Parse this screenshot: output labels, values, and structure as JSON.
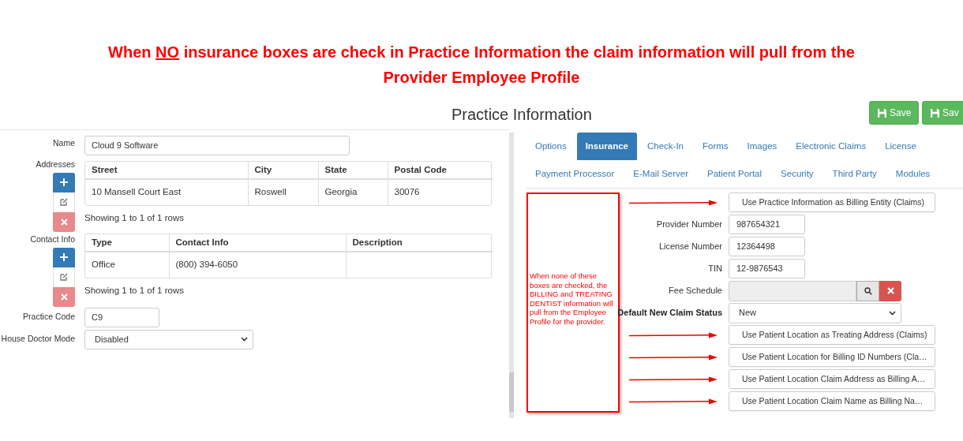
{
  "annotation": {
    "lead": "When ",
    "emphasis": "NO",
    "rest": " insurance boxes are check in Practice Information the claim information will pull from the Provider Employee Profile"
  },
  "page_title": "Practice Information",
  "save_buttons": [
    {
      "label": "Save"
    },
    {
      "label": "Sav"
    }
  ],
  "general": {
    "name": {
      "label": "Name",
      "value": "Cloud 9 Software"
    },
    "addresses": {
      "label": "Addresses",
      "columns": [
        "Street",
        "City",
        "State",
        "Postal Code"
      ],
      "rows": [
        [
          "10 Mansell Court East",
          "Roswell",
          "Georgia",
          "30076"
        ]
      ],
      "footer": "Showing 1 to 1 of 1 rows"
    },
    "contact_info": {
      "label": "Contact Info",
      "columns": [
        "Type",
        "Contact Info",
        "Description"
      ],
      "rows": [
        [
          "Office",
          "(800) 394-6050",
          ""
        ]
      ],
      "footer": "Showing 1 to 1 of 1 rows"
    },
    "practice_code": {
      "label": "Practice Code",
      "value": "C9"
    },
    "house_doctor_mode": {
      "label": "House Doctor Mode",
      "value": "Disabled"
    }
  },
  "tabs": [
    [
      {
        "label": "Options",
        "selected": false
      },
      {
        "label": "Insurance",
        "selected": true
      },
      {
        "label": "Check-In",
        "selected": false
      },
      {
        "label": "Forms",
        "selected": false
      },
      {
        "label": "Images",
        "selected": false
      },
      {
        "label": "Electronic Claims",
        "selected": false
      },
      {
        "label": "License",
        "selected": false
      }
    ],
    [
      {
        "label": "Payment Processor",
        "selected": false
      },
      {
        "label": "E-Mail Server",
        "selected": false
      },
      {
        "label": "Patient Portal",
        "selected": false
      },
      {
        "label": "Security",
        "selected": false
      },
      {
        "label": "Third Party",
        "selected": false
      },
      {
        "label": "Modules",
        "selected": false
      }
    ]
  ],
  "note": "When none of these boxes are checked, the BILLING and TREATING DENTIST information will pull from the Employee Profile for the provider.",
  "insurance": [
    {
      "kind": "toggle",
      "label": "Use Practice Information as Billing Entity (Claims)",
      "checked": false,
      "arrow": true
    },
    {
      "kind": "field",
      "label": "Provider Number",
      "value": "987654321"
    },
    {
      "kind": "field",
      "label": "License Number",
      "value": "12364498"
    },
    {
      "kind": "field",
      "label": "TIN",
      "value": "12-9876543"
    },
    {
      "kind": "lookup",
      "label": "Fee Schedule"
    },
    {
      "kind": "select",
      "label": "Default New Claim Status",
      "value": "New"
    },
    {
      "kind": "toggle",
      "label": "Use Patient Location as Treating Address (Claims)",
      "checked": false,
      "arrow": true
    },
    {
      "kind": "toggle",
      "label": "Use Patient Location for Billing ID Numbers (Cla…",
      "checked": false,
      "arrow": true
    },
    {
      "kind": "toggle",
      "label": "Use Patient Location Claim Address as Billing A…",
      "checked": false,
      "arrow": true
    },
    {
      "kind": "toggle",
      "label": "Use Patient Location Claim Name as Billing Na…",
      "checked": false,
      "arrow": true
    }
  ]
}
